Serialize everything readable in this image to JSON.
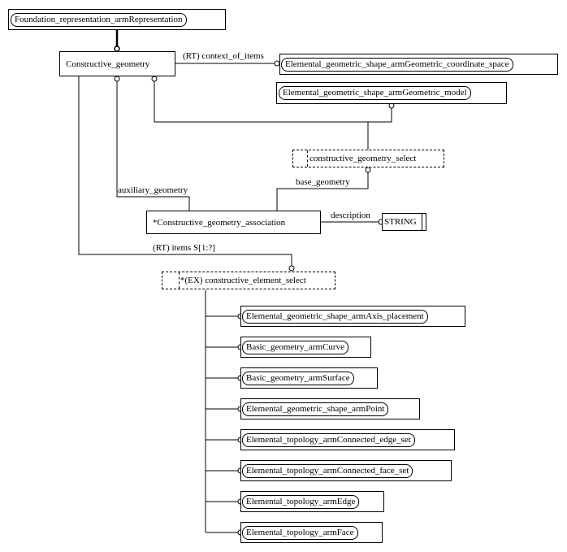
{
  "diagram": {
    "type": "EXPRESS-G schema diagram",
    "root": "Foundation_representation_armRepresentation",
    "entities": {
      "constructive_geometry": "Constructive_geometry",
      "geometric_coordinate_space": "Elemental_geometric_shape_armGeometric_coordinate_space",
      "geometric_model": "Elemental_geometric_shape_armGeometric_model",
      "constructive_geometry_select": "constructive_geometry_select",
      "constructive_geometry_association": "*Constructive_geometry_association",
      "string_type": "STRING",
      "constructive_element_select": "*(EX) constructive_element_select"
    },
    "relations": {
      "context_of_items": "(RT) context_of_items",
      "auxiliary_geometry": "auxiliary_geometry",
      "base_geometry": "base_geometry",
      "description": "description",
      "items": "(RT) items S[1:?]"
    },
    "select_members": [
      "Elemental_geometric_shape_armAxis_placement",
      "Basic_geometry_armCurve",
      "Basic_geometry_armSurface",
      "Elemental_geometric_shape_armPoint",
      "Elemental_topology_armConnected_edge_set",
      "Elemental_topology_armConnected_face_set",
      "Elemental_topology_armEdge",
      "Elemental_topology_armFace"
    ]
  }
}
